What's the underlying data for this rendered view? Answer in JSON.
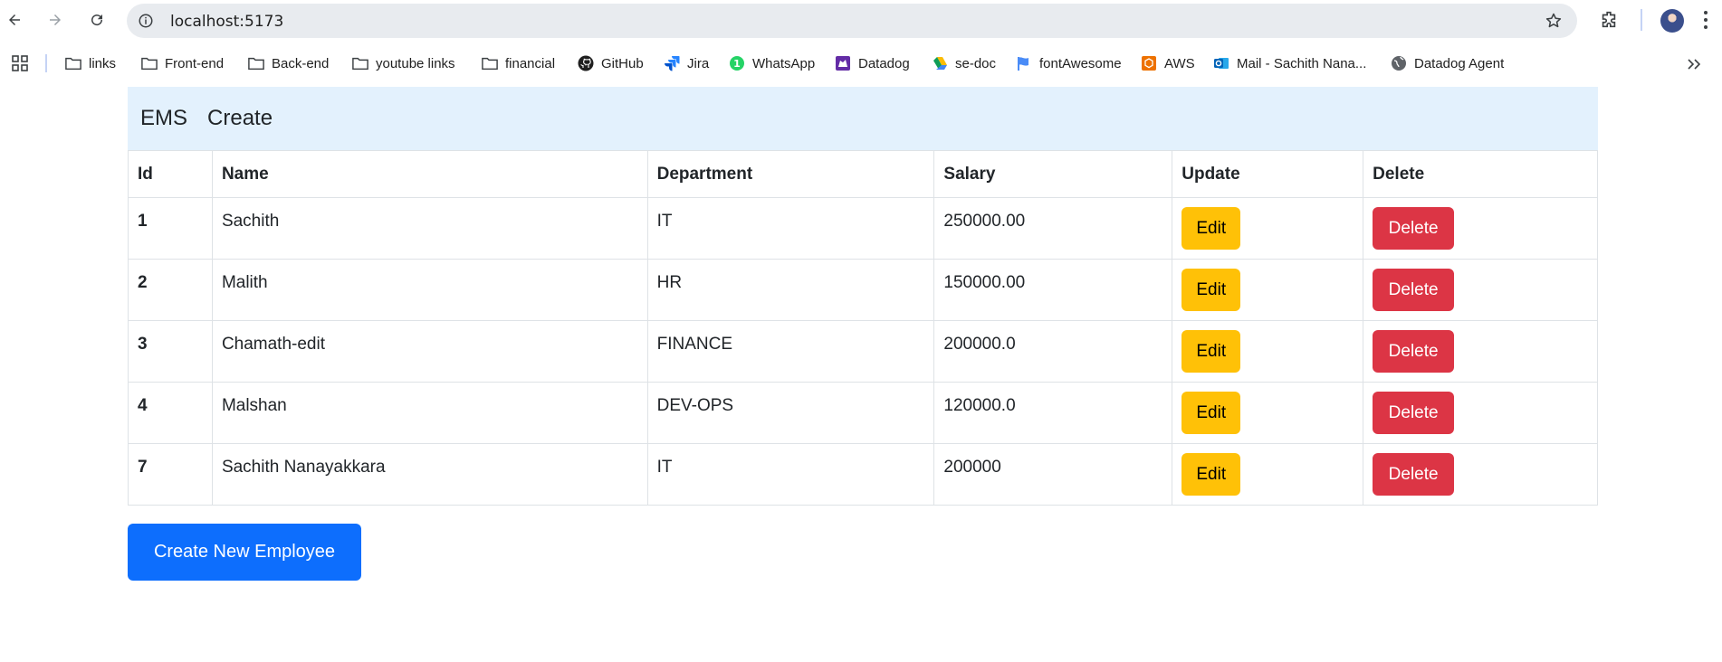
{
  "browser": {
    "url": "localhost:5173",
    "icons": [
      "back-icon",
      "forward-icon",
      "reload-icon",
      "info-icon",
      "star-icon",
      "extensions-icon",
      "avatar",
      "menu-icon"
    ]
  },
  "bookmarks": [
    {
      "label": "links",
      "icon": "folder-icon"
    },
    {
      "label": "Front-end",
      "icon": "folder-icon"
    },
    {
      "label": "Back-end",
      "icon": "folder-icon"
    },
    {
      "label": "youtube links",
      "icon": "folder-icon"
    },
    {
      "label": "financial",
      "icon": "folder-icon"
    },
    {
      "label": "GitHub",
      "icon": "github-icon"
    },
    {
      "label": "Jira",
      "icon": "jira-icon"
    },
    {
      "label": "WhatsApp",
      "icon": "whatsapp-icon"
    },
    {
      "label": "Datadog",
      "icon": "datadog-icon"
    },
    {
      "label": "se-doc",
      "icon": "drive-icon"
    },
    {
      "label": "fontAwesome",
      "icon": "flag-icon"
    },
    {
      "label": "AWS",
      "icon": "aws-icon"
    },
    {
      "label": "Mail - Sachith Nana...",
      "icon": "outlook-icon"
    },
    {
      "label": "Datadog Agent",
      "icon": "globe-icon"
    }
  ],
  "navbar": {
    "brand": "EMS",
    "link": "Create",
    "bg": "#e3f1fd"
  },
  "table": {
    "headers": [
      "Id",
      "Name",
      "Department",
      "Salary",
      "Update",
      "Delete"
    ],
    "rows": [
      {
        "id": "1",
        "name": "Sachith",
        "department": "IT",
        "salary": "250000.00"
      },
      {
        "id": "2",
        "name": "Malith",
        "department": "HR",
        "salary": "150000.00"
      },
      {
        "id": "3",
        "name": "Chamath-edit",
        "department": "FINANCE",
        "salary": "200000.0"
      },
      {
        "id": "4",
        "name": "Malshan",
        "department": "DEV-OPS",
        "salary": "120000.0"
      },
      {
        "id": "7",
        "name": "Sachith Nanayakkara",
        "department": "IT",
        "salary": "200000"
      }
    ],
    "edit_label": "Edit",
    "delete_label": "Delete"
  },
  "create_button": "Create New Employee",
  "colors": {
    "edit": "#ffc107",
    "delete": "#dc3545",
    "primary": "#0d6efd"
  }
}
